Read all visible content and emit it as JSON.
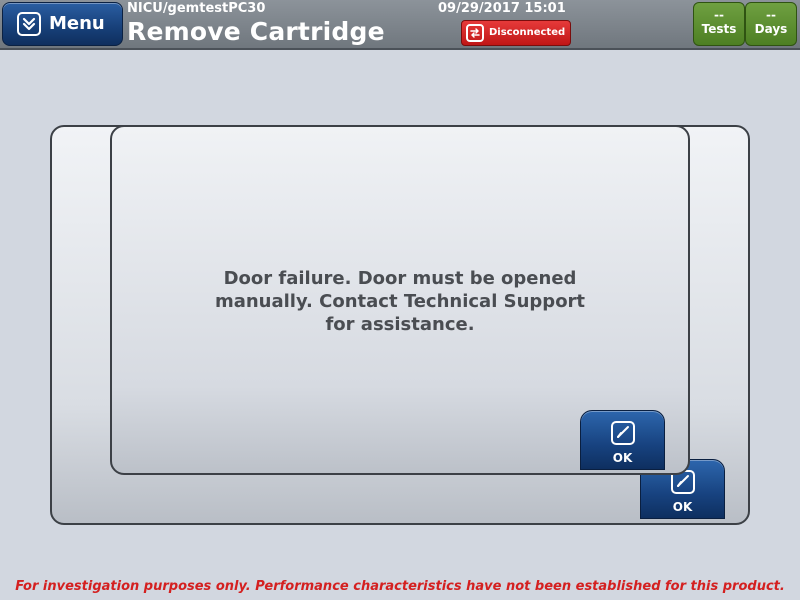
{
  "header": {
    "menu_label": "Menu",
    "menu_icon": "chevron-double-down-icon",
    "location": "NICU/gemtestPC30",
    "title": "Remove Cartridge",
    "datetime": "09/29/2017 15:01",
    "connection_status": "Disconnected",
    "connection_icon": "disconnected-icon",
    "tests_value": "--",
    "tests_label": "Tests",
    "days_value": "--",
    "days_label": "Days"
  },
  "dialog": {
    "message_lines": [
      "Door failure. Door must be opened",
      "manually. Contact Technical Support",
      "for assistance."
    ],
    "ok_label": "OK",
    "ok_icon": "checkbox-check-icon"
  },
  "background_dialog": {
    "ok_label": "OK",
    "ok_icon": "checkbox-check-icon"
  },
  "footer": {
    "disclaimer": "For investigation purposes only.  Performance characteristics have not been established for this product."
  },
  "colors": {
    "header_bg": "#7f868d",
    "menu_blue": "#173f78",
    "disconnected_red": "#d42020",
    "counter_green": "#5b8c2e",
    "page_bg": "#d2d7e0",
    "disclaimer_red": "#d42020"
  }
}
